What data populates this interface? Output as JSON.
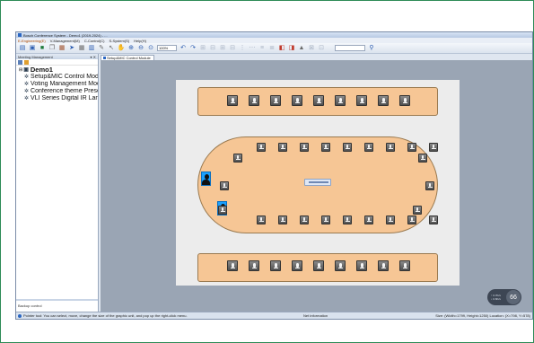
{
  "window": {
    "title": "Bosch Conference System - Demo1 (2019-2024) - ..."
  },
  "menu": {
    "items": [
      "E-Engineering(E)",
      "V-Management(M)",
      "C-Control(C)",
      "S-System(S)",
      "Help(H)"
    ]
  },
  "toolbar": {
    "zoom_value": "100%"
  },
  "sidepanel": {
    "header": "Meeting Management",
    "tree": {
      "root": "Demo1",
      "children": [
        "Setup&MIC Control Module",
        "Voting Management Module",
        "Conference theme Presentation",
        "VLI Series Digital IR Language"
      ]
    },
    "bottom_label": "Backup control"
  },
  "document_tab": {
    "label": "Setup&MIC Control Module"
  },
  "canvas": {
    "mic_label": "Mic",
    "center_device_label": "Main unit"
  },
  "statusbar": {
    "hint": "Pointer tool: You can select, move, change the size of the graphic unit, and pop up the right-click menu.",
    "info": "Net information",
    "size": "Size: (Width=1799, Height=1250)  Location: (X=798, Y=578)"
  },
  "gauge": {
    "top": "↑ 0.7K/s",
    "bottom": "↓ 0.6K/s",
    "value": "66"
  },
  "colors": {
    "table": "#f6c695",
    "chairman": "#1aa0ff",
    "canvas_bg": "#9aa5b4",
    "paper": "#ececec"
  }
}
